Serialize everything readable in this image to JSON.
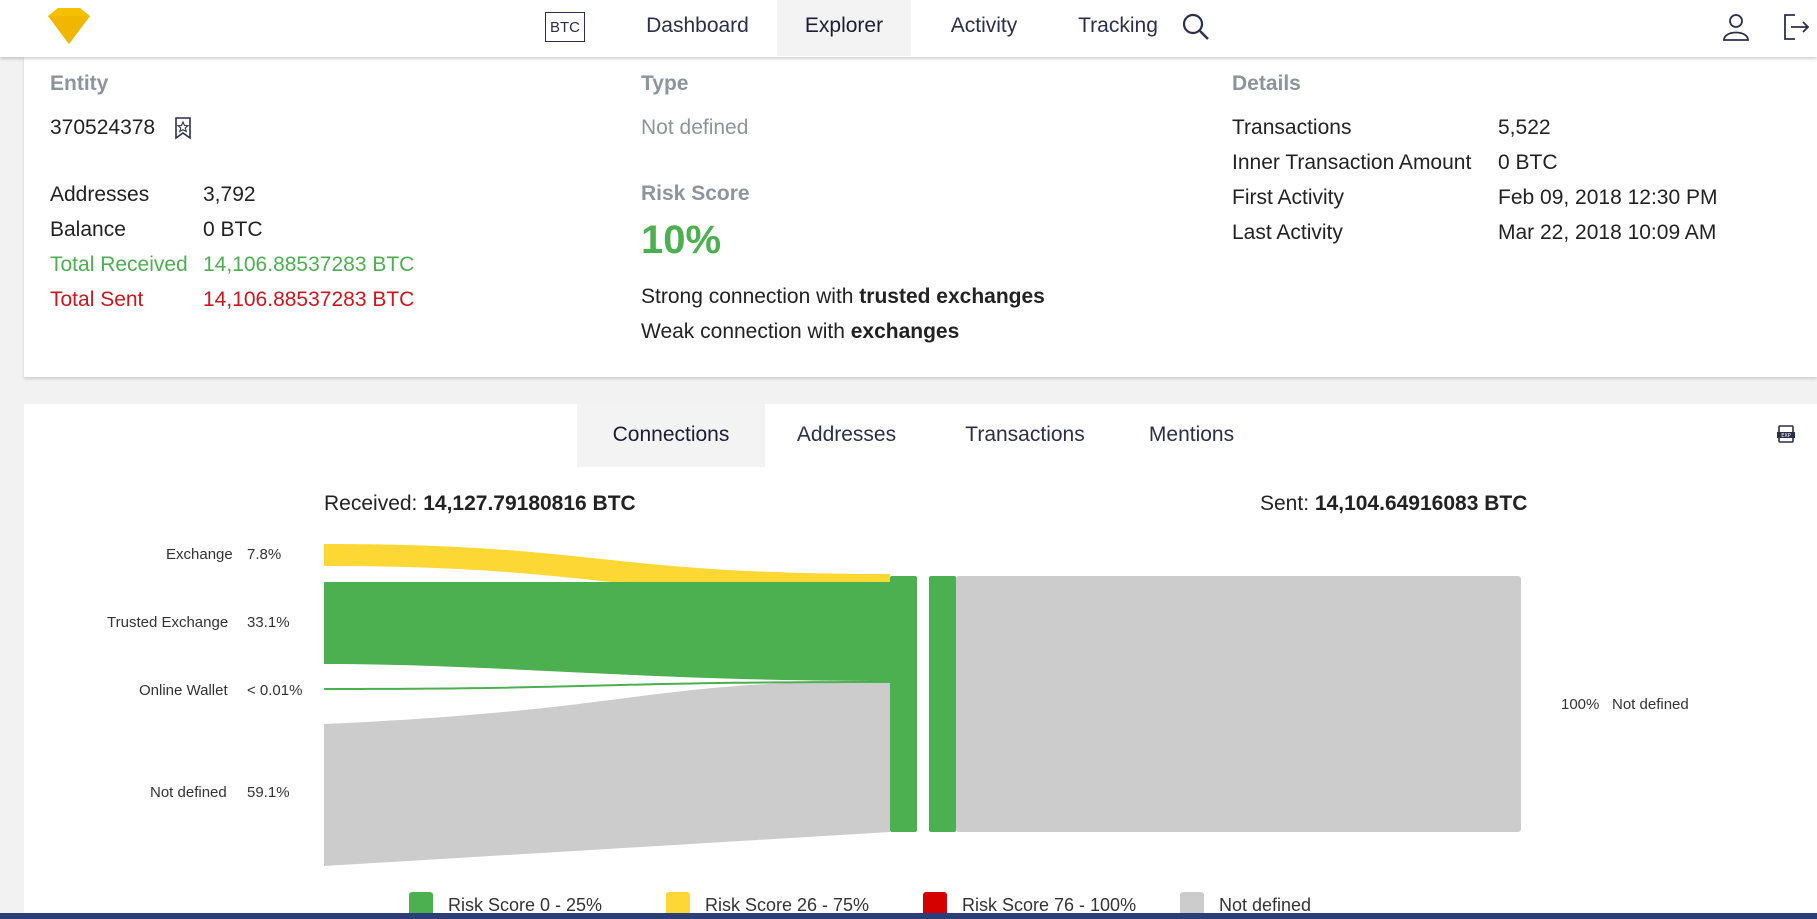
{
  "nav": {
    "currency": "BTC",
    "items": [
      "Dashboard",
      "Explorer",
      "Activity",
      "Tracking"
    ],
    "active": "Explorer"
  },
  "entity": {
    "heading": "Entity",
    "id": "370524378",
    "rows": [
      {
        "label": "Addresses",
        "value": "3,792"
      },
      {
        "label": "Balance",
        "value": "0 BTC"
      },
      {
        "label": "Total Received",
        "value": "14,106.88537283 BTC"
      },
      {
        "label": "Total Sent",
        "value": "14,106.88537283 BTC"
      }
    ]
  },
  "type": {
    "heading": "Type",
    "value": "Not defined",
    "risk_heading": "Risk Score",
    "risk_value": "10%",
    "line1_prefix": "Strong connection with ",
    "line1_bold": "trusted exchanges",
    "line2_prefix": "Weak connection with ",
    "line2_bold": "exchanges"
  },
  "details": {
    "heading": "Details",
    "rows": [
      {
        "label": "Transactions",
        "value": "5,522"
      },
      {
        "label": "Inner Transaction Amount",
        "value": "0 BTC"
      },
      {
        "label": "First Activity",
        "value": "Feb 09, 2018 12:30 PM"
      },
      {
        "label": "Last Activity",
        "value": "Mar 22, 2018 10:09 AM"
      }
    ]
  },
  "tabs": [
    "Connections",
    "Addresses",
    "Transactions",
    "Mentions"
  ],
  "tabs_active": "Connections",
  "flow": {
    "received_label": "Received: ",
    "received_value": "14,127.79180816 BTC",
    "sent_label": "Sent: ",
    "sent_value": "14,104.64916083 BTC",
    "inputs": [
      {
        "name": "Exchange",
        "pct": "7.8%",
        "share": 0.078,
        "color": "#fdd835"
      },
      {
        "name": "Trusted Exchange",
        "pct": "33.1%",
        "share": 0.331,
        "color": "#4caf50"
      },
      {
        "name": "Online Wallet",
        "pct": "< 0.01%",
        "share": 0.0001,
        "color": "#4caf50"
      },
      {
        "name": "Not defined",
        "pct": "59.1%",
        "share": 0.591,
        "color": "#cccccc"
      }
    ],
    "outputs": [
      {
        "name": "Not defined",
        "pct": "100%",
        "share": 1.0,
        "color": "#cccccc"
      }
    ]
  },
  "legend": [
    {
      "label": "Risk Score 0 - 25%",
      "color": "#4caf50"
    },
    {
      "label": "Risk Score 26 - 75%",
      "color": "#fdd835"
    },
    {
      "label": "Risk Score 76 - 100%",
      "color": "#d50000"
    },
    {
      "label": "Not defined",
      "color": "#cccccc"
    }
  ],
  "colors": {
    "brand": "#f5c000",
    "green": "#4caf50",
    "red": "#d0161d",
    "nav_text": "#2b2f4a"
  }
}
